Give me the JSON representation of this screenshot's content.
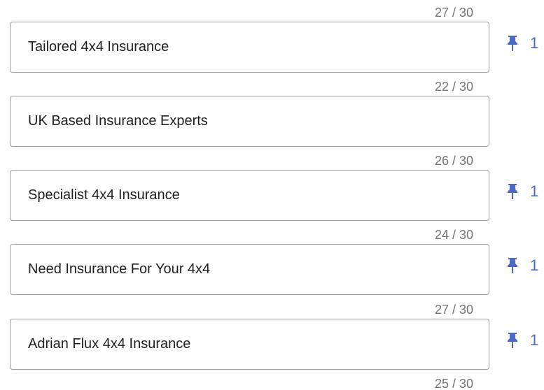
{
  "headlines": [
    {
      "text": "Tailored 4x4 Insurance",
      "counter": "27 / 30",
      "pinned": true,
      "pin_position": "1"
    },
    {
      "text": "UK Based Insurance Experts",
      "counter": "22 / 30",
      "pinned": false,
      "pin_position": ""
    },
    {
      "text": "Specialist 4x4 Insurance",
      "counter": "26 / 30",
      "pinned": true,
      "pin_position": "1"
    },
    {
      "text": "Need Insurance For Your 4x4",
      "counter": "24 / 30",
      "pinned": true,
      "pin_position": "1"
    },
    {
      "text": "Adrian Flux 4x4 Insurance",
      "counter": "27 / 30",
      "pinned": true,
      "pin_position": "1"
    }
  ],
  "next_counter": "25 / 30",
  "colors": {
    "pin_accent": "#4d6bc6",
    "counter_text": "#757575",
    "border": "#9e9e9e"
  },
  "icons": {
    "pin": "pushpin-icon"
  }
}
